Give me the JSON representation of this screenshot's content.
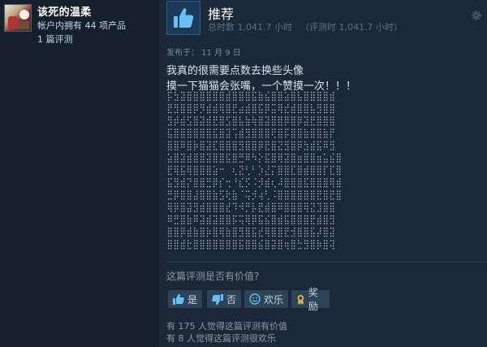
{
  "reviewer": {
    "name": "该死的温柔",
    "products_owned": "帐户内拥有 44 项产品",
    "review_count": "1 篇评测"
  },
  "review": {
    "verdict": "推荐",
    "hours_total": "总时数 1,041.7 小时",
    "hours_at_review": "（评测时 1,041.7 小时）",
    "posted": "发布于：  11 月 9 日",
    "line1": "我真的很需要点数去换些头像",
    "line2": "摸一下猫猫会张嘴，一个赞摸一次！！！"
  },
  "helpful": {
    "question": "这篇评测是否有价值?",
    "yes_label": "是",
    "no_label": "否",
    "funny_label": "欢乐",
    "award_label": "奖励",
    "helpful_stat": "有 175 人觉得这篇评测有价值",
    "funny_stat": "有 8 人觉得这篇评测很欢乐"
  },
  "colors": {
    "background": "#1b2838",
    "panel": "#16202d",
    "button": "#2e4357",
    "accent_blue": "#66c0f4",
    "award_gold": "#e3b84a"
  },
  "icons": {
    "recommend": "thumbs-up-icon",
    "settings": "gear-icon",
    "yes": "thumbs-up-icon",
    "no": "thumbs-down-icon",
    "funny": "smiley-icon",
    "award": "award-ribbon-icon"
  }
}
